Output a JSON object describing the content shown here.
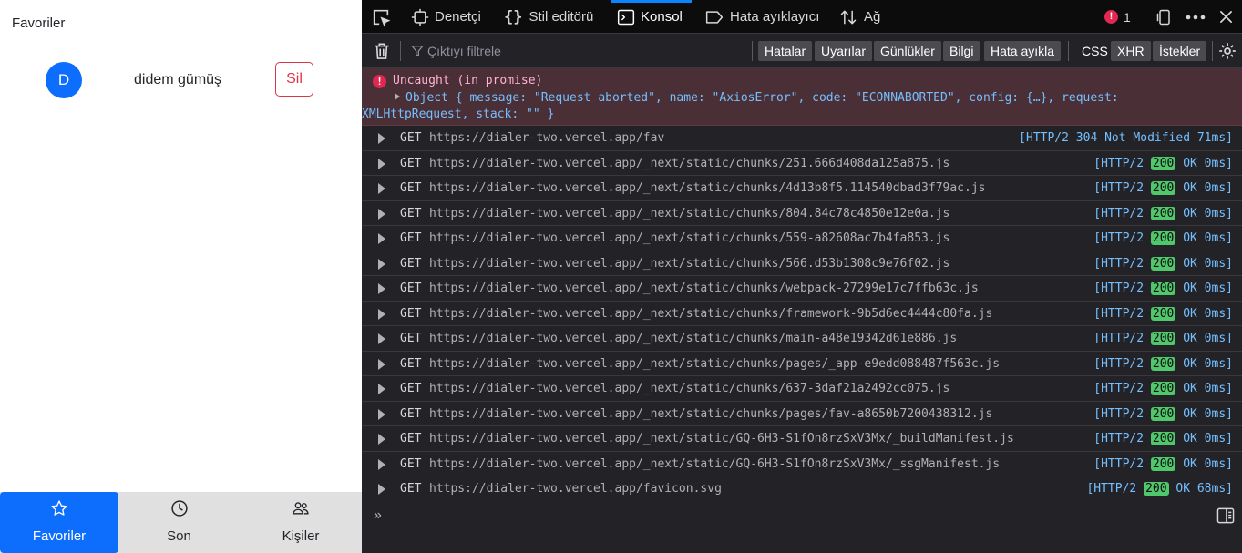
{
  "app": {
    "title": "Favoriler",
    "contact": {
      "initial": "D",
      "name": "didem gümüş",
      "delete_label": "Sil"
    },
    "nav": [
      {
        "label": "Favoriler",
        "icon": "star-icon",
        "active": true
      },
      {
        "label": "Son",
        "icon": "clock-icon",
        "active": false
      },
      {
        "label": "Kişiler",
        "icon": "people-icon",
        "active": false
      }
    ],
    "accent_color": "#0d6efd"
  },
  "devtools": {
    "tabs": [
      {
        "label": "Denetçi",
        "icon": "inspector-icon"
      },
      {
        "label": "Stil editörü",
        "icon": "braces-icon"
      },
      {
        "label": "Konsol",
        "icon": "console-icon",
        "active": true
      },
      {
        "label": "Hata ayıklayıcı",
        "icon": "debugger-icon"
      },
      {
        "label": "Ağ",
        "icon": "network-arrows-icon"
      }
    ],
    "error_count": "1",
    "filter_placeholder": "Çıktıyı filtrele",
    "filters": [
      "Hatalar",
      "Uyarılar",
      "Günlükler",
      "Bilgi",
      "Hata ayıkla"
    ],
    "filters_right": [
      {
        "label": "CSS",
        "highlighted": false
      },
      {
        "label": "XHR",
        "highlighted": true
      },
      {
        "label": "İstekler",
        "highlighted": true
      }
    ],
    "error": {
      "title": "Uncaught (in promise)",
      "line2": "Object { message: \"Request aborted\", name: \"AxiosError\", code: \"ECONNABORTED\", config: {…}, request:",
      "line3": "XMLHttpRequest, stack: \"\" }"
    },
    "logs": [
      {
        "method": "GET",
        "url": "https://dialer-two.vercel.app/fav",
        "proto": "[HTTP/2",
        "code": "304",
        "text": "Not Modified 71ms]"
      },
      {
        "method": "GET",
        "url": "https://dialer-two.vercel.app/_next/static/chunks/251.666d408da125a875.js",
        "proto": "[HTTP/2",
        "code": "200",
        "text": "OK 0ms]"
      },
      {
        "method": "GET",
        "url": "https://dialer-two.vercel.app/_next/static/chunks/4d13b8f5.114540dbad3f79ac.js",
        "proto": "[HTTP/2",
        "code": "200",
        "text": "OK 0ms]"
      },
      {
        "method": "GET",
        "url": "https://dialer-two.vercel.app/_next/static/chunks/804.84c78c4850e12e0a.js",
        "proto": "[HTTP/2",
        "code": "200",
        "text": "OK 0ms]"
      },
      {
        "method": "GET",
        "url": "https://dialer-two.vercel.app/_next/static/chunks/559-a82608ac7b4fa853.js",
        "proto": "[HTTP/2",
        "code": "200",
        "text": "OK 0ms]"
      },
      {
        "method": "GET",
        "url": "https://dialer-two.vercel.app/_next/static/chunks/566.d53b1308c9e76f02.js",
        "proto": "[HTTP/2",
        "code": "200",
        "text": "OK 0ms]"
      },
      {
        "method": "GET",
        "url": "https://dialer-two.vercel.app/_next/static/chunks/webpack-27299e17c7ffb63c.js",
        "proto": "[HTTP/2",
        "code": "200",
        "text": "OK 0ms]"
      },
      {
        "method": "GET",
        "url": "https://dialer-two.vercel.app/_next/static/chunks/framework-9b5d6ec4444c80fa.js",
        "proto": "[HTTP/2",
        "code": "200",
        "text": "OK 0ms]"
      },
      {
        "method": "GET",
        "url": "https://dialer-two.vercel.app/_next/static/chunks/main-a48e19342d61e886.js",
        "proto": "[HTTP/2",
        "code": "200",
        "text": "OK 0ms]"
      },
      {
        "method": "GET",
        "url": "https://dialer-two.vercel.app/_next/static/chunks/pages/_app-e9edd088487f563c.js",
        "proto": "[HTTP/2",
        "code": "200",
        "text": "OK 0ms]"
      },
      {
        "method": "GET",
        "url": "https://dialer-two.vercel.app/_next/static/chunks/637-3daf21a2492cc075.js",
        "proto": "[HTTP/2",
        "code": "200",
        "text": "OK 0ms]"
      },
      {
        "method": "GET",
        "url": "https://dialer-two.vercel.app/_next/static/chunks/pages/fav-a8650b7200438312.js",
        "proto": "[HTTP/2",
        "code": "200",
        "text": "OK 0ms]"
      },
      {
        "method": "GET",
        "url": "https://dialer-two.vercel.app/_next/static/GQ-6H3-S1fOn8rzSxV3Mx/_buildManifest.js",
        "proto": "[HTTP/2",
        "code": "200",
        "text": "OK 0ms]"
      },
      {
        "method": "GET",
        "url": "https://dialer-two.vercel.app/_next/static/GQ-6H3-S1fOn8rzSxV3Mx/_ssgManifest.js",
        "proto": "[HTTP/2",
        "code": "200",
        "text": "OK 0ms]"
      },
      {
        "method": "GET",
        "url": "https://dialer-two.vercel.app/favicon.svg",
        "proto": "[HTTP/2",
        "code": "200",
        "text": "OK 68ms]"
      }
    ],
    "prompt": "»"
  }
}
